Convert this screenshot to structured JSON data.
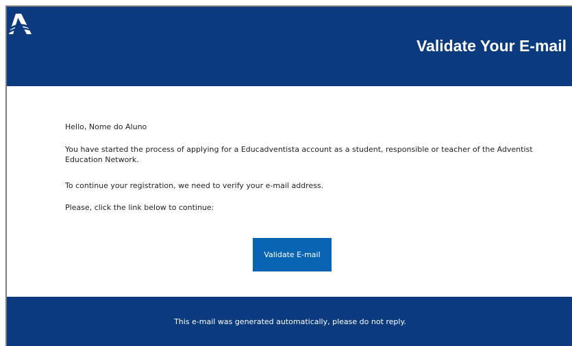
{
  "header": {
    "logo_icon": "adventist-logo-icon",
    "title": "Validate Your E-mail",
    "background": "#0b3a7e"
  },
  "body": {
    "greeting": "Hello, Nome do Aluno",
    "paragraph_1": "You have started the process of applying for a Educadventista account as a student, responsible or teacher of the Adventist Education Network.",
    "paragraph_2": "To continue your registration, we need to verify your e-mail address.",
    "paragraph_3": "Please, click the link below to continue:"
  },
  "button": {
    "label": "Validate E-mail",
    "color": "#0a64b4"
  },
  "footer": {
    "text": "This e-mail was generated automatically, please do not reply.",
    "background": "#0b3a7e"
  }
}
